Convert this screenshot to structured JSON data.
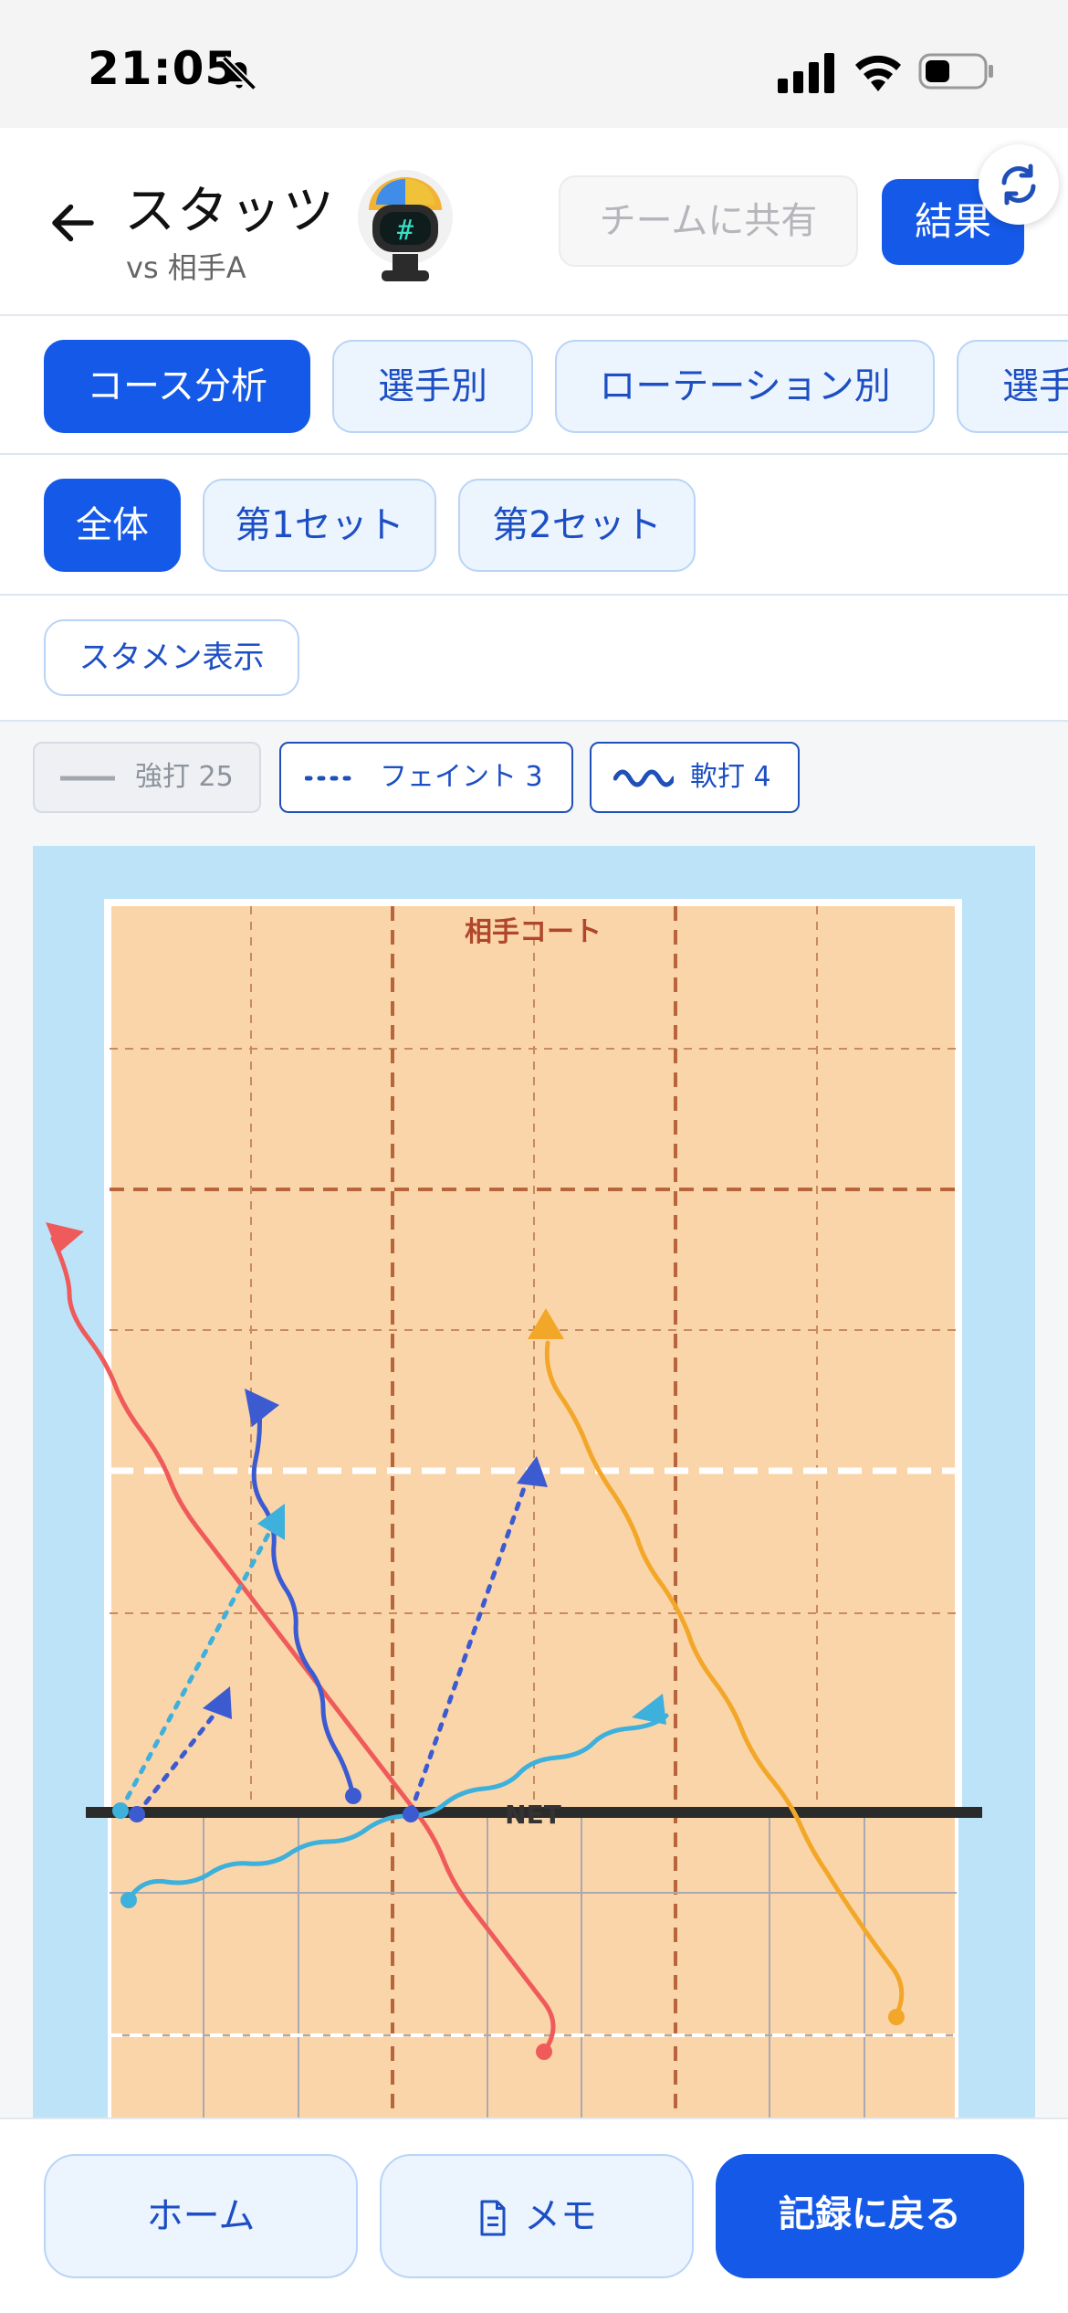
{
  "status": {
    "time": "21:05"
  },
  "header": {
    "title": "スタッツ",
    "subtitle": "vs 相手A",
    "share_placeholder": "チームに共有",
    "result_label": "結果"
  },
  "tabs": [
    {
      "label": "コース分析",
      "active": true
    },
    {
      "label": "選手別",
      "active": false
    },
    {
      "label": "ローテーション別",
      "active": false
    },
    {
      "label": "選手",
      "active": false
    }
  ],
  "sets": [
    {
      "label": "全体",
      "active": true
    },
    {
      "label": "第1セット",
      "active": false
    },
    {
      "label": "第2セット",
      "active": false
    }
  ],
  "starter_toggle": "スタメン表示",
  "legend": [
    {
      "label": "強打 25",
      "style": "solid",
      "enabled": false
    },
    {
      "label": "フェイント 3",
      "style": "dotted",
      "enabled": true
    },
    {
      "label": "軟打 4",
      "style": "wavy",
      "enabled": true
    }
  ],
  "court": {
    "opponent_label": "相手コート",
    "net_label": "NET"
  },
  "colors": {
    "primary": "#1559e8",
    "court": "#fbd5aa",
    "outside": "#bde3f9",
    "red": "#ef5b5b",
    "blue": "#3c5bd1",
    "cyan": "#3db0dc",
    "orange": "#f2a729"
  },
  "bottom": {
    "home": "ホーム",
    "memo": "メモ",
    "back_to_record": "記録に戻る"
  }
}
